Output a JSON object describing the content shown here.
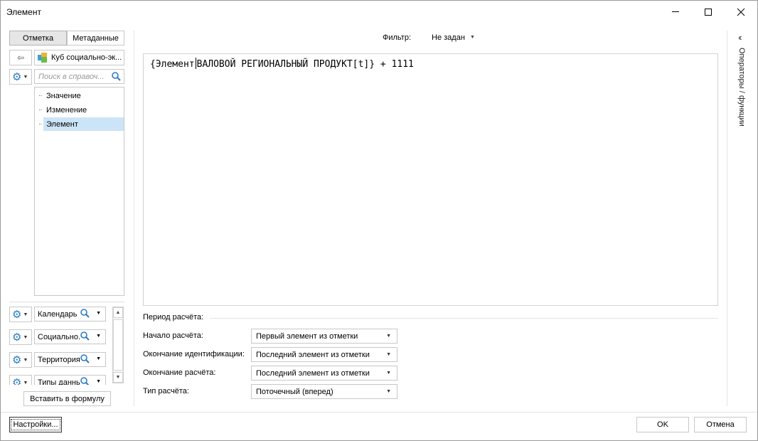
{
  "window": {
    "title": "Элемент"
  },
  "left": {
    "tabs": [
      "Отметка",
      "Метаданные"
    ],
    "active_tab": 0,
    "cube_name": "Куб социально-эк...",
    "search_placeholder": "Поиск в справоч...",
    "tree_items": [
      "Значение",
      "Изменение",
      "Элемент"
    ],
    "selected_tree_item": 2,
    "dimensions": [
      "Календарь",
      "Социально...",
      "Территория",
      "Типы данных"
    ],
    "insert_button": "Вставить в формулу"
  },
  "main": {
    "filter_label": "Фильтр:",
    "filter_value": "Не задан",
    "formula_part1": "{Элемент",
    "formula_part2": "ВАЛОВОЙ РЕГИОНАЛЬНЫЙ ПРОДУКТ[t]} + 1111",
    "period_title": "Период расчёта:",
    "params": [
      {
        "label": "Начало расчёта:",
        "value": "Первый элемент из отметки"
      },
      {
        "label": "Окончание идентификации:",
        "value": "Последний элемент из отметки"
      },
      {
        "label": "Окончание расчёта:",
        "value": "Последний элемент из отметки"
      },
      {
        "label": "Тип расчёта:",
        "value": "Поточечный (вперед)"
      }
    ]
  },
  "right_panel": {
    "label": "Операторы / функции"
  },
  "footer": {
    "settings": "Настройки...",
    "ok": "OK",
    "cancel": "Отмена"
  },
  "icons": [
    "minimize-icon",
    "maximize-icon",
    "close-icon",
    "back-arrow-icon",
    "cube-icon",
    "gear-icon",
    "search-icon",
    "chevron-down-icon",
    "double-chevron-left-icon"
  ]
}
